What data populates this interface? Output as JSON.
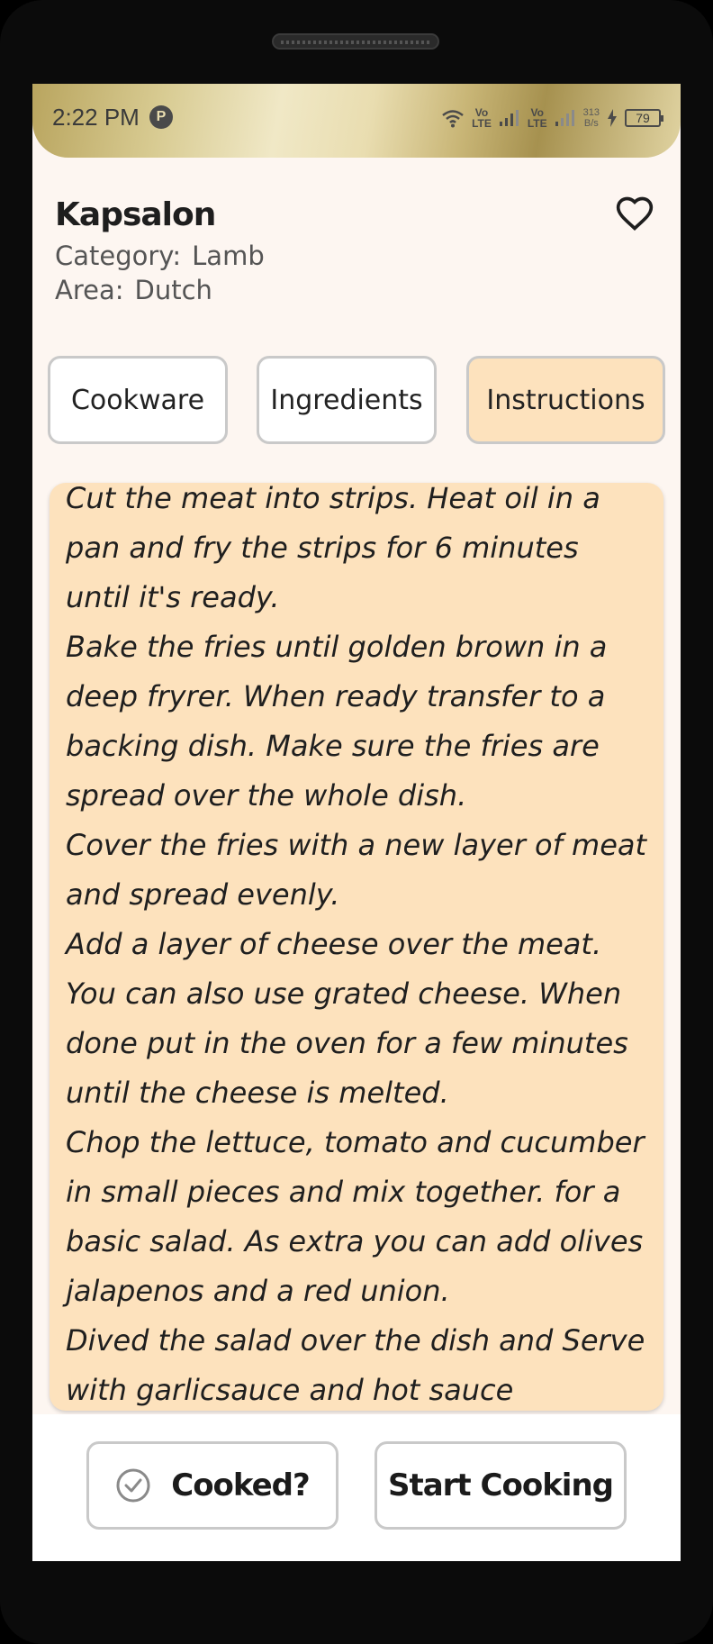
{
  "status_bar": {
    "time": "2:22 PM",
    "p_icon": "P",
    "net1": "Vo\nLTE",
    "net2": "Vo\nLTE",
    "speed": "313\nB/s",
    "battery": "79",
    "icons": [
      "p-notification-icon",
      "wifi-icon",
      "signal-icon",
      "signal-icon",
      "charging-icon",
      "battery-icon"
    ]
  },
  "meal": {
    "title": "Kapsalon",
    "category_label": "Category:",
    "category": "Lamb",
    "area_label": "Area:",
    "area": "Dutch",
    "favorite_icon": "heart-outline-icon"
  },
  "tabs": [
    {
      "label": "Cookware",
      "active": false
    },
    {
      "label": "Ingredients",
      "active": false
    },
    {
      "label": "Instructions",
      "active": true
    }
  ],
  "instructions": "Cut the meat into strips. Heat oil in a pan and fry the strips for 6 minutes until it's ready.\nBake the fries until golden brown in a deep fryrer. When ready transfer to a backing dish. Make sure the fries are spread over the whole dish.\nCover the fries with a new layer of meat and spread evenly.\nAdd a layer of cheese over the meat. You can also use grated cheese. When done put in the oven for a few minutes until the cheese is melted.\nChop the lettuce, tomato and cucumber in small pieces and mix together. for a basic salad. As extra you can add olives jalapenos and a red union.\nDived the salad over the dish and Serve with garlicsauce and hot sauce",
  "actions": {
    "cooked_label": "Cooked?",
    "cooked_icon": "check-circle-icon",
    "start_label": "Start Cooking"
  },
  "colors": {
    "accent": "#fde2bd",
    "background": "#fdf6f1",
    "border": "#c9c9c9"
  }
}
